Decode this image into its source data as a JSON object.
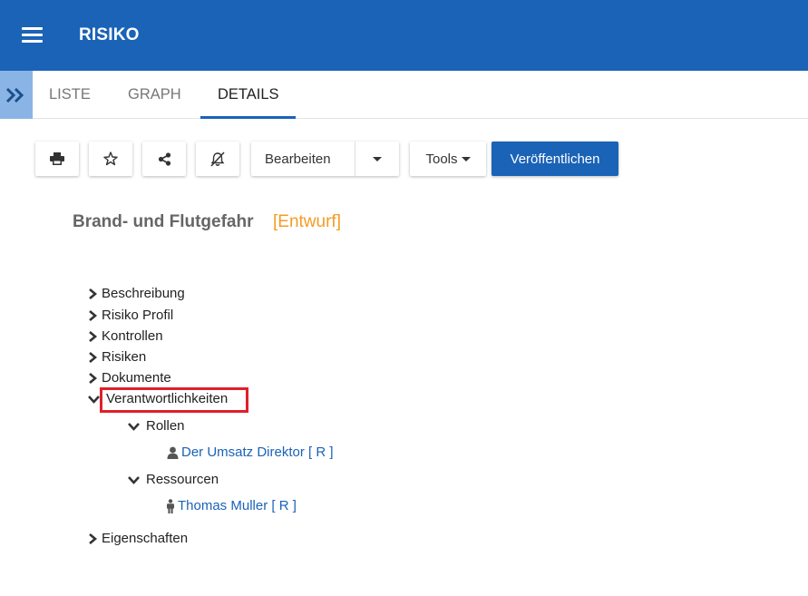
{
  "header": {
    "title": "RISIKO",
    "menu_icon": "hamburger-menu-icon",
    "bg_color": "#1a63b7"
  },
  "tabs": [
    {
      "label": "LISTE",
      "active": false
    },
    {
      "label": "GRAPH",
      "active": false
    },
    {
      "label": "DETAILS",
      "active": true
    }
  ],
  "toolbar": {
    "print_icon": "print-icon",
    "favorite_icon": "star-icon",
    "share_icon": "share-icon",
    "notify_icon": "bell-slash-icon",
    "edit_label": "Bearbeiten",
    "tools_label": "Tools",
    "publish_label": "Veröffentlichen"
  },
  "document": {
    "title": "Brand- und Flutgefahr",
    "status": "[Entwurf]",
    "status_color": "#f39c24"
  },
  "tree": {
    "sections": [
      {
        "label": "Beschreibung",
        "expanded": false
      },
      {
        "label": "Risiko Profil",
        "expanded": false
      },
      {
        "label": "Kontrollen",
        "expanded": false
      },
      {
        "label": "Risiken",
        "expanded": false
      },
      {
        "label": "Dokumente",
        "expanded": false
      },
      {
        "label": "Verantwortlichkeiten",
        "expanded": true,
        "highlighted": true
      },
      {
        "label": "Eigenschaften",
        "expanded": false
      }
    ],
    "roles": {
      "label": "Rollen",
      "item": "Der Umsatz Direktor [ R ]",
      "item_icon": "user-icon"
    },
    "resources": {
      "label": "Ressourcen",
      "item": "Thomas Muller [ R ]",
      "item_icon": "person-icon"
    }
  }
}
